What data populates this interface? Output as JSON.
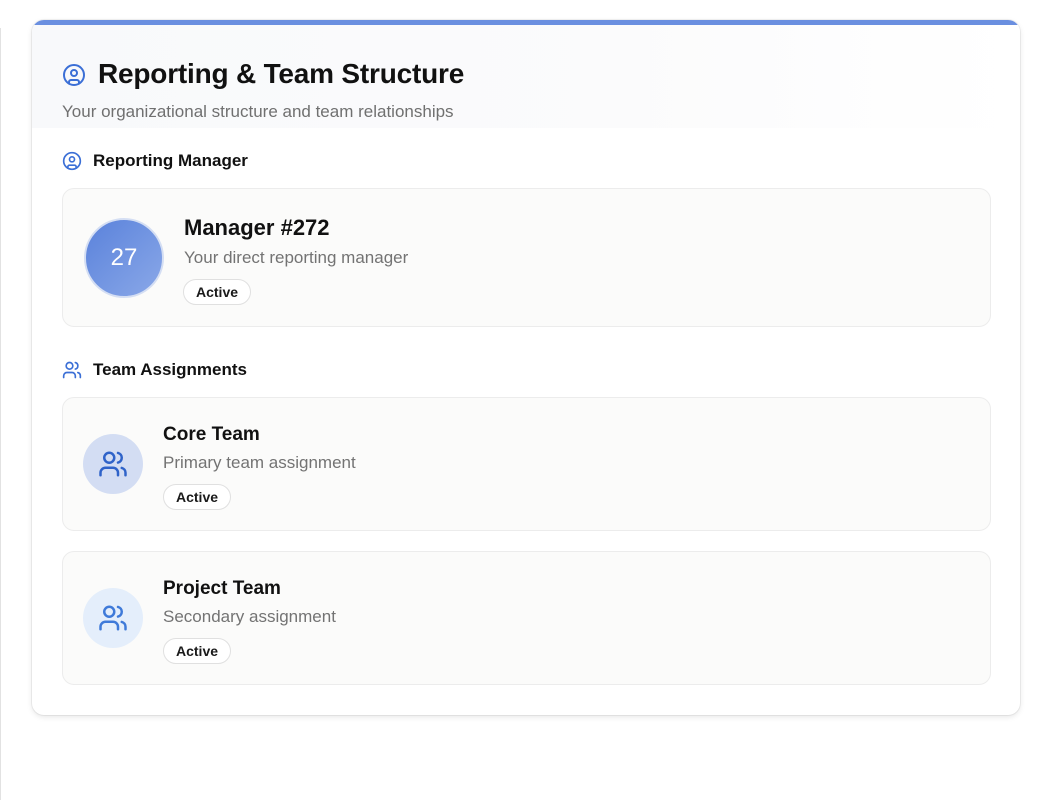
{
  "page": {
    "title": "Reporting & Team Structure",
    "subtitle": "Your organizational structure and team relationships",
    "header_icon": "user-circle-icon",
    "accent_color": "#6a8fe0"
  },
  "reporting_manager": {
    "section_title": "Reporting Manager",
    "section_icon": "user-circle-icon",
    "avatar_text": "27",
    "name": "Manager #272",
    "description": "Your direct reporting manager",
    "status": "Active"
  },
  "team_assignments": {
    "section_title": "Team Assignments",
    "section_icon": "users-icon",
    "teams": [
      {
        "name": "Core Team",
        "description": "Primary team assignment",
        "status": "Active",
        "icon": "users-icon"
      },
      {
        "name": "Project Team",
        "description": "Secondary assignment",
        "status": "Active",
        "icon": "users-icon"
      }
    ]
  }
}
